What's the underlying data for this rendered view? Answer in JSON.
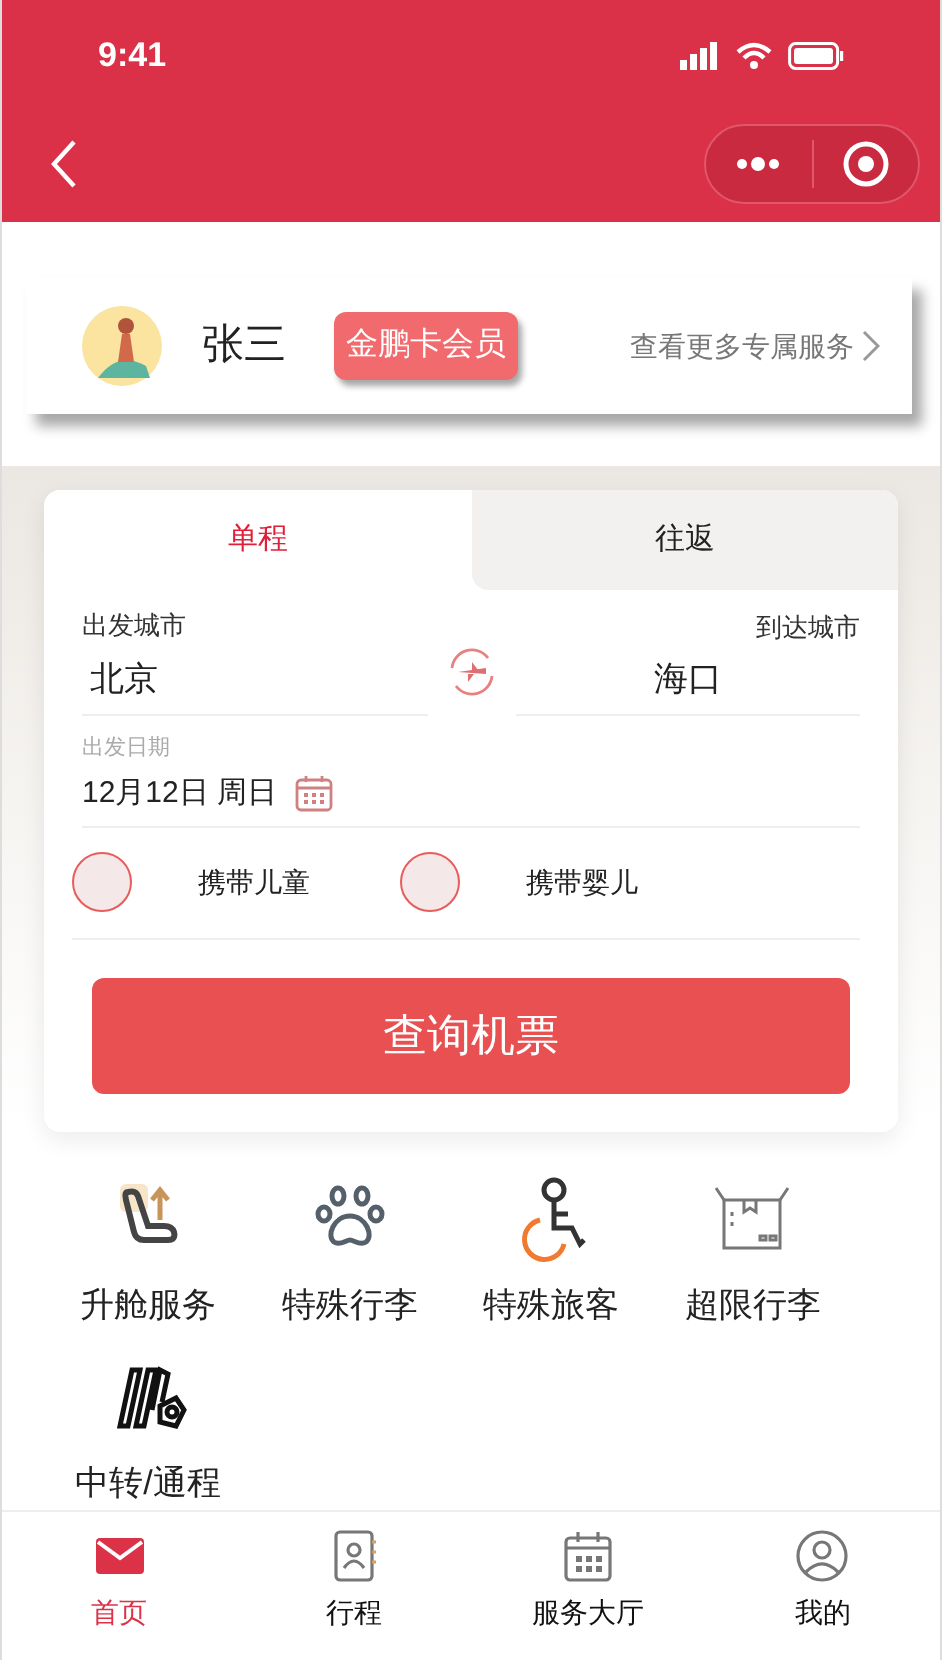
{
  "status_bar": {
    "time": "9:41"
  },
  "member": {
    "name": "张三",
    "badge": "金鹏卡会员",
    "link": "查看更多专属服务"
  },
  "booking": {
    "tabs": [
      {
        "label": "单程",
        "selected": true
      },
      {
        "label": "往返",
        "selected": false
      }
    ],
    "from": {
      "label": "出发城市",
      "value": "北京"
    },
    "to": {
      "label": "到达城市",
      "value": "海口"
    },
    "date": {
      "label": "出发日期",
      "value": "12月12日 周日"
    },
    "options": [
      {
        "label": "携带儿童",
        "checked": false
      },
      {
        "label": "携带婴儿",
        "checked": false
      }
    ],
    "search_button": "查询机票"
  },
  "services": [
    {
      "kind": "seat",
      "label": "升舱服务"
    },
    {
      "kind": "paw",
      "label": "特殊行李"
    },
    {
      "kind": "wheelchair",
      "label": "特殊旅客"
    },
    {
      "kind": "box",
      "label": "超限行李"
    },
    {
      "kind": "transfer",
      "label": "中转/通程"
    }
  ],
  "tab_bar": [
    {
      "kind": "home",
      "label": "首页",
      "selected": true
    },
    {
      "kind": "trips",
      "label": "行程",
      "selected": false
    },
    {
      "kind": "hall",
      "label": "服务大厅",
      "selected": false
    },
    {
      "kind": "me",
      "label": "我的",
      "selected": false
    }
  ]
}
